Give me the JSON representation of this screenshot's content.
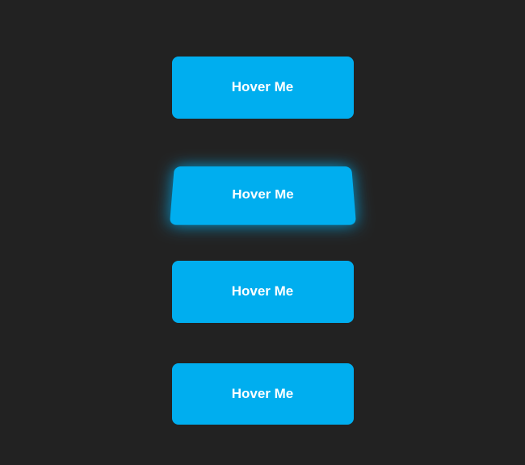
{
  "buttons": [
    {
      "label": "Hover Me"
    },
    {
      "label": "Hover Me"
    },
    {
      "label": "Hover Me"
    },
    {
      "label": "Hover Me"
    }
  ],
  "accentColor": "#00aeef",
  "backgroundColor": "#222"
}
